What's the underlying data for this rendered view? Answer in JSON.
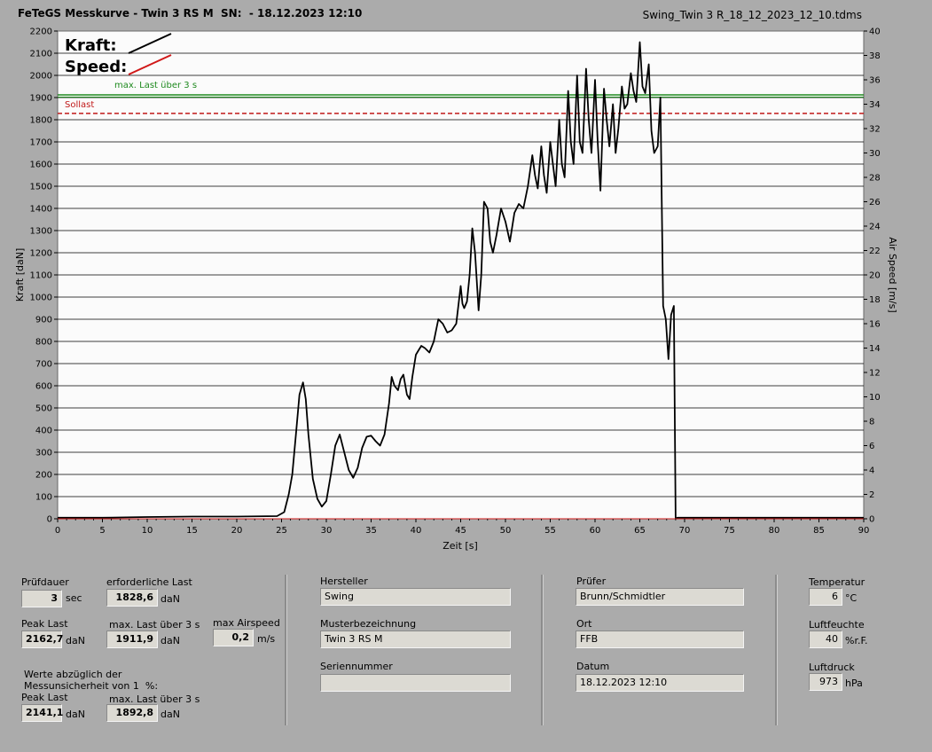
{
  "header": {
    "title": "FeTeGS Messkurve - Twin 3 RS M  SN:  - 18.12.2023 12:10",
    "filename": "Swing_Twin 3 R_18_12_2023_12_10.tdms"
  },
  "chart_data": {
    "type": "line",
    "xlabel": "Zeit [s]",
    "ylabel": "Kraft [daN]",
    "y2label": "Air Speed [m/s]",
    "xlim": [
      0,
      90
    ],
    "ylim": [
      0,
      2200
    ],
    "y2lim": [
      0,
      40
    ],
    "xticks": [
      0,
      5,
      10,
      15,
      20,
      25,
      30,
      35,
      40,
      45,
      50,
      55,
      60,
      65,
      70,
      75,
      80,
      85,
      90
    ],
    "yticks": [
      0,
      100,
      200,
      300,
      400,
      500,
      600,
      700,
      800,
      900,
      1000,
      1100,
      1200,
      1300,
      1400,
      1500,
      1600,
      1700,
      1800,
      1900,
      2000,
      2100,
      2200
    ],
    "y2ticks": [
      0,
      2,
      4,
      6,
      8,
      10,
      12,
      14,
      16,
      18,
      20,
      22,
      24,
      26,
      28,
      30,
      32,
      34,
      36,
      38,
      40
    ],
    "grid": "horizontal",
    "legend": {
      "kraft_label": "Kraft:",
      "speed_label": "Speed:",
      "kraft_color": "#000000",
      "speed_color": "#d01818"
    },
    "reference_lines": [
      {
        "name": "max. Last über  3 s",
        "value": 1911.9,
        "color": "#1f8a1f",
        "style": "solid"
      },
      {
        "name": "Sollast",
        "value": 1828.6,
        "color": "#c01818",
        "style": "dashed"
      }
    ],
    "series": [
      {
        "name": "Kraft",
        "color": "#000000",
        "x": [
          0,
          5,
          10,
          15,
          20,
          24.5,
          25.3,
          25.8,
          26.2,
          26.6,
          27,
          27.4,
          27.7,
          28.0,
          28.5,
          29,
          29.5,
          30,
          30.5,
          31,
          31.5,
          32,
          32.5,
          33,
          33.5,
          34,
          34.5,
          35,
          35.5,
          36,
          36.5,
          37,
          37.3,
          37.6,
          38,
          38.3,
          38.6,
          39,
          39.3,
          39.6,
          40,
          40.3,
          40.6,
          41,
          41.5,
          42,
          42.5,
          43,
          43.5,
          44,
          44.5,
          45,
          45.2,
          45.4,
          45.7,
          46,
          46.3,
          46.6,
          47,
          47.3,
          47.6,
          48,
          48.3,
          48.6,
          49,
          49.5,
          50,
          50.5,
          51,
          51.5,
          52,
          52.5,
          53,
          53.3,
          53.6,
          54,
          54.3,
          54.6,
          55,
          55.3,
          55.6,
          56,
          56.3,
          56.6,
          57,
          57.3,
          57.6,
          58,
          58.3,
          58.6,
          59,
          59.3,
          59.6,
          60,
          60.3,
          60.6,
          61,
          61.3,
          61.6,
          62,
          62.3,
          62.6,
          63,
          63.3,
          63.6,
          64,
          64.3,
          64.6,
          65,
          65.3,
          65.6,
          66,
          66.3,
          66.6,
          67,
          67.3,
          67.6,
          67.9,
          68.2,
          68.5,
          68.8,
          69.0,
          69.2,
          70,
          75,
          80,
          85,
          90
        ],
        "y": [
          5,
          5,
          8,
          10,
          10,
          12,
          30,
          110,
          200,
          380,
          560,
          615,
          540,
          380,
          180,
          90,
          55,
          80,
          200,
          330,
          380,
          300,
          220,
          185,
          230,
          320,
          370,
          375,
          350,
          330,
          380,
          520,
          640,
          600,
          580,
          630,
          650,
          560,
          540,
          640,
          740,
          760,
          780,
          770,
          750,
          800,
          900,
          880,
          840,
          850,
          880,
          1050,
          970,
          950,
          980,
          1100,
          1310,
          1200,
          940,
          1100,
          1430,
          1400,
          1250,
          1200,
          1280,
          1400,
          1340,
          1250,
          1380,
          1420,
          1400,
          1500,
          1640,
          1550,
          1490,
          1680,
          1550,
          1470,
          1700,
          1600,
          1500,
          1800,
          1600,
          1540,
          1930,
          1700,
          1600,
          2000,
          1700,
          1650,
          2030,
          1800,
          1650,
          1980,
          1700,
          1480,
          1940,
          1800,
          1680,
          1870,
          1650,
          1760,
          1950,
          1850,
          1870,
          2010,
          1930,
          1880,
          2150,
          1950,
          1920,
          2050,
          1750,
          1650,
          1680,
          1900,
          960,
          900,
          720,
          920,
          960,
          0,
          5,
          5,
          5,
          5,
          5,
          5
        ]
      },
      {
        "name": "Speed",
        "color": "#d01818",
        "x": [
          0,
          90
        ],
        "y": [
          0,
          0
        ]
      }
    ]
  },
  "panel": {
    "pruefdauer": {
      "label": "Prüfdauer",
      "value": "3",
      "unit": "sec"
    },
    "erforderliche_last": {
      "label": "erforderliche Last",
      "value": "1828,6",
      "unit": "daN"
    },
    "peak_last": {
      "label": "Peak Last",
      "value": "2162,7",
      "unit": "daN"
    },
    "max_last": {
      "label": "max. Last über  3 s",
      "value": "1911,9",
      "unit": "daN"
    },
    "max_airspeed": {
      "label": "max Airspeed",
      "value": "0,2",
      "unit": "m/s"
    },
    "werte_note": "Werte abzüglich der\nMessunsicherheit von 1  %:",
    "peak_last2": {
      "label": "Peak Last",
      "value": "2141,1",
      "unit": "daN"
    },
    "max_last2": {
      "label": "max. Last über  3 s",
      "value": "1892,8",
      "unit": "daN"
    },
    "hersteller": {
      "label": "Hersteller",
      "value": "Swing"
    },
    "musterbezeichnung": {
      "label": "Musterbezeichnung",
      "value": "Twin 3 RS M"
    },
    "seriennummer": {
      "label": "Seriennummer",
      "value": ""
    },
    "pruefer": {
      "label": "Prüfer",
      "value": "Brunn/Schmidtler"
    },
    "ort": {
      "label": "Ort",
      "value": "FFB"
    },
    "datum": {
      "label": "Datum",
      "value": "18.12.2023 12:10"
    },
    "temperatur": {
      "label": "Temperatur",
      "value": "6",
      "unit": "°C"
    },
    "luftfeuchte": {
      "label": "Luftfeuchte",
      "value": "40",
      "unit": "%r.F."
    },
    "luftdruck": {
      "label": "Luftdruck",
      "value": "973",
      "unit": "hPa"
    }
  }
}
